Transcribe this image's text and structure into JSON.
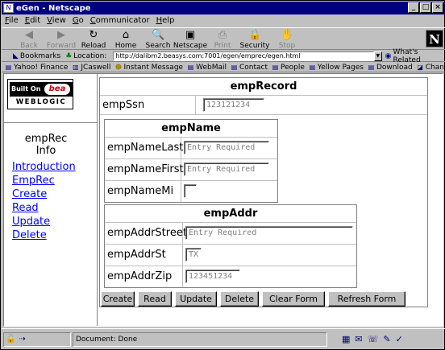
{
  "window": {
    "title": "eGen - Netscape",
    "controls": [
      "_",
      "□",
      "×"
    ]
  },
  "menu": [
    {
      "underline": "F",
      "rest": "ile"
    },
    {
      "underline": "E",
      "rest": "dit"
    },
    {
      "underline": "V",
      "rest": "iew"
    },
    {
      "underline": "G",
      "rest": "o"
    },
    {
      "underline": "C",
      "rest": "ommunicator"
    },
    {
      "underline": "H",
      "rest": "elp"
    }
  ],
  "toolbar": {
    "buttons": [
      {
        "label": "Back",
        "icon": "back-arrow-icon",
        "glyph": "◀",
        "enabled": false
      },
      {
        "label": "Forward",
        "icon": "forward-arrow-icon",
        "glyph": "▶",
        "enabled": false
      },
      {
        "label": "Reload",
        "icon": "reload-icon",
        "glyph": "↻",
        "enabled": true
      },
      {
        "label": "Home",
        "icon": "home-icon",
        "glyph": "⌂",
        "enabled": true
      },
      {
        "label": "Search",
        "icon": "search-icon",
        "glyph": "🔍",
        "enabled": true
      },
      {
        "label": "Netscape",
        "icon": "netscape-icon",
        "glyph": "▣",
        "enabled": true
      },
      {
        "label": "Print",
        "icon": "print-icon",
        "glyph": "⎙",
        "enabled": false
      },
      {
        "label": "Security",
        "icon": "security-lock-icon",
        "glyph": "🔒",
        "enabled": true
      },
      {
        "label": "Stop",
        "icon": "stop-icon",
        "glyph": "✋",
        "enabled": false
      }
    ],
    "brand": "N"
  },
  "location": {
    "bookmarks_label": "Bookmarks",
    "location_label": "Location:",
    "url": "http://dalibm2.beasys.com:7001/egen/emprec/egen.html",
    "related_label": "What's Related"
  },
  "personal": [
    "Yahoo! Finance",
    "JCaswell",
    "Instant Message",
    "WebMail",
    "Contact",
    "People",
    "Yellow Pages",
    "Download",
    "Channels"
  ],
  "sidebar": {
    "logo": {
      "built_on": "Built On",
      "brand": "bea",
      "product": "WEBLOGIC"
    },
    "title_line1": "empRec",
    "title_line2": "Info",
    "links": [
      "Introduction",
      "EmpRec",
      "Create",
      "Read",
      "Update",
      "Delete"
    ]
  },
  "form": {
    "title": "empRecord",
    "ssn": {
      "label": "empSsn",
      "value": "123121234"
    },
    "name": {
      "title": "empName",
      "last": {
        "label": "empNameLast",
        "value": "Entry Required"
      },
      "first": {
        "label": "empNameFirst",
        "value": "Entry Required"
      },
      "mi": {
        "label": "empNameMi",
        "value": ""
      }
    },
    "addr": {
      "title": "empAddr",
      "street": {
        "label": "empAddrStreet",
        "value": "Entry Required"
      },
      "st": {
        "label": "empAddrSt",
        "value": "TX"
      },
      "zip": {
        "label": "empAddrZip",
        "value": "123451234"
      }
    },
    "buttons": [
      "Create",
      "Read",
      "Update",
      "Delete",
      "Clear Form",
      "Refresh Form"
    ]
  },
  "status": {
    "text": "Document: Done"
  }
}
